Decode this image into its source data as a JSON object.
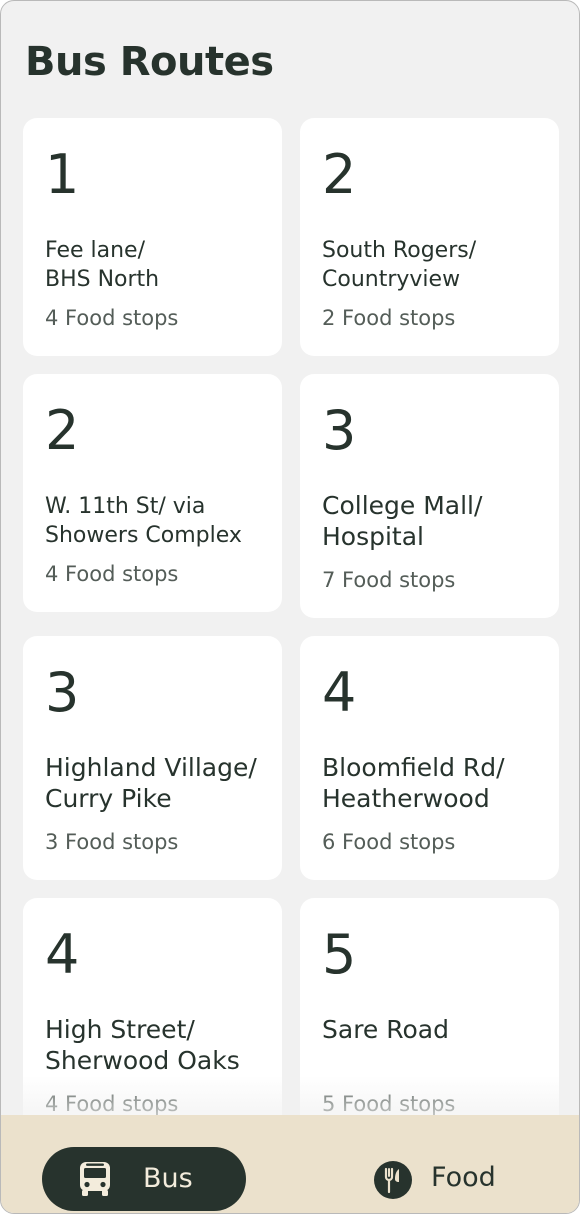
{
  "header": {
    "title": "Bus Routes"
  },
  "routes": [
    {
      "number": "1",
      "name": "Fee lane/\nBHS North",
      "stops": "4 Food stops"
    },
    {
      "number": "2",
      "name": "South Rogers/\nCountryview",
      "stops": "2 Food stops"
    },
    {
      "number": "2",
      "name": "W. 11th St/ via\nShowers Complex",
      "stops": "4 Food stops"
    },
    {
      "number": "3",
      "name": "College Mall/\nHospital",
      "stops": "7 Food stops"
    },
    {
      "number": "3",
      "name": "Highland Village/\nCurry Pike",
      "stops": "3 Food stops"
    },
    {
      "number": "4",
      "name": "Bloomfield Rd/\nHeatherwood",
      "stops": "6 Food stops"
    },
    {
      "number": "4",
      "name": "High Street/\nSherwood Oaks",
      "stops": "4 Food stops"
    },
    {
      "number": "5",
      "name": "Sare Road",
      "stops": "5 Food stops"
    }
  ],
  "bottom_nav": {
    "bus_label": "Bus",
    "bus_icon": "bus-icon",
    "food_label": "Food",
    "food_icon": "fork-knife-icon",
    "active": "Bus"
  },
  "colors": {
    "primary_dark": "#27332d",
    "background": "#f1f1f1",
    "card": "#ffffff",
    "nav_background": "#ebe1cc",
    "muted_text": "#545d58"
  }
}
